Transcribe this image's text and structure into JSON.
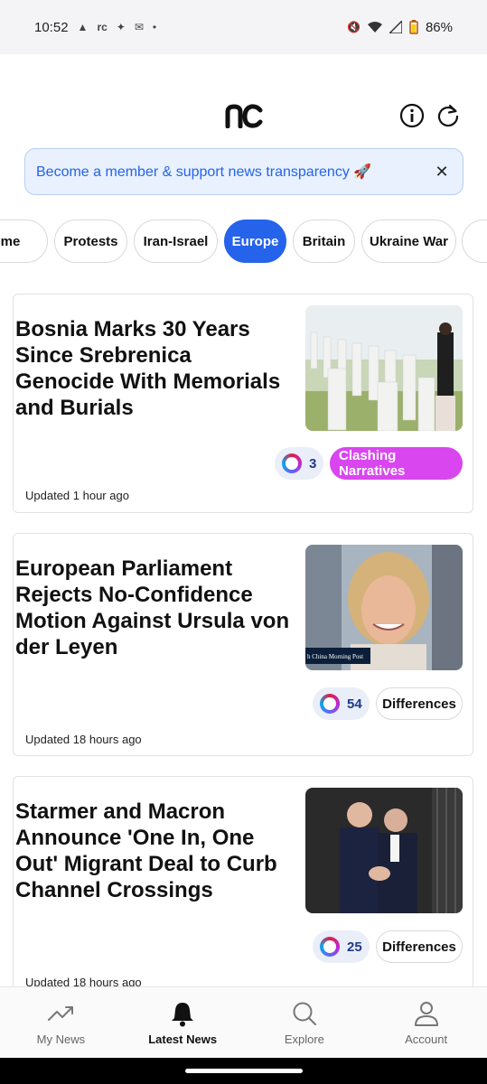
{
  "status_bar": {
    "time": "10:52",
    "left_icons": [
      "tree-icon",
      "nc-icon",
      "slack-icon",
      "mail-icon",
      "dot-icon"
    ],
    "battery": "86%",
    "right_icons": [
      "mute-icon",
      "wifi-icon",
      "signal-icon",
      "battery-icon"
    ]
  },
  "header": {
    "logo": "nc",
    "info_icon": "info-icon",
    "refresh_icon": "refresh-icon"
  },
  "banner": {
    "text": "Become a member & support news transparency 🚀",
    "close_icon": "close-icon"
  },
  "categories": {
    "items": [
      {
        "label": "rime"
      },
      {
        "label": "Protests"
      },
      {
        "label": "Iran-Israel"
      },
      {
        "label": "Europe",
        "active": true
      },
      {
        "label": "Britain"
      },
      {
        "label": "Ukraine War"
      },
      {
        "label": ""
      }
    ]
  },
  "articles": [
    {
      "title": "Bosnia Marks 30 Years Since Srebrenica Genocide With Memorials and Burials",
      "source_count": "3",
      "tag": "Clashing Narratives",
      "updated": "Updated 1 hour ago"
    },
    {
      "title": "European Parliament Rejects No-Confidence Motion Against Ursula von der Leyen",
      "source_count": "54",
      "tag": "Differences",
      "image_caption": "h China Morning Post",
      "updated": "Updated 18 hours ago"
    },
    {
      "title": "Starmer and Macron Announce 'One In, One Out' Migrant Deal to Curb Channel Crossings",
      "source_count": "25",
      "tag": "Differences",
      "updated": "Updated 18 hours ago"
    }
  ],
  "bottom_nav": {
    "items": [
      {
        "label": "My News",
        "icon": "trending-icon"
      },
      {
        "label": "Latest News",
        "icon": "bell-icon",
        "active": true
      },
      {
        "label": "Explore",
        "icon": "search-icon"
      },
      {
        "label": "Account",
        "icon": "person-icon"
      }
    ]
  },
  "colors": {
    "accent": "#2563eb",
    "clash_tag": "#d946ef",
    "banner_bg": "#e8f1fd"
  }
}
